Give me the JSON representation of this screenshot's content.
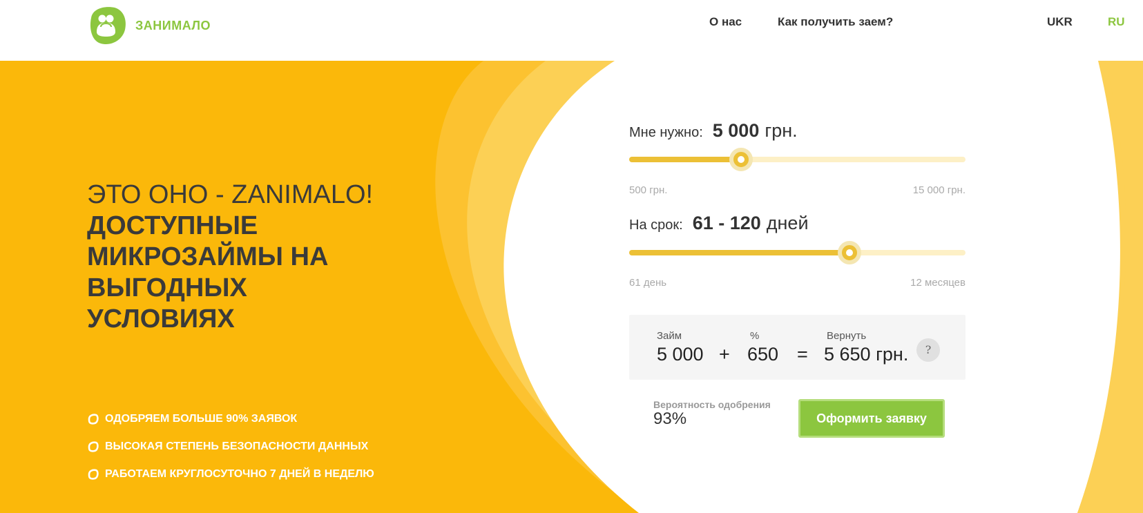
{
  "brand": {
    "name": "ЗАНИМАЛО",
    "color": "#8cc63f"
  },
  "nav": {
    "about": "О нас",
    "how_to": "Как получить заем?",
    "lang_ukr": "UKR",
    "lang_ru": "RU",
    "active_lang": "RU"
  },
  "hero": {
    "title_light": "ЭТО ОНО - ZANIMALO!",
    "title_bold": "ДОСТУПНЫЕ МИКРОЗАЙМЫ НА ВЫГОДНЫХ УСЛОВИЯХ",
    "features": [
      "ОДОБРЯЕМ БОЛЬШЕ 90% ЗАЯВОК",
      "ВЫСОКАЯ СТЕПЕНЬ БЕЗОПАСНОСТИ ДАННЫХ",
      "РАБОТАЕМ КРУГЛОСУТОЧНО 7 ДНЕЙ В НЕДЕЛЮ"
    ],
    "background_color": "#fbb80a"
  },
  "calculator": {
    "amount": {
      "label": "Мне нужно:",
      "value": "5 000",
      "unit": "грн.",
      "min_label": "500 грн.",
      "max_label": "15 000 грн.",
      "fill_fraction": 0.333
    },
    "term": {
      "label": "На срок:",
      "value": "61 - 120",
      "unit": "дней",
      "min_label": "61 день",
      "max_label": "12 месяцев",
      "fill_fraction": 0.655
    },
    "summary": {
      "loan_label": "Займ",
      "loan_value": "5 000",
      "plus": "+",
      "percent_label": "%",
      "percent_value": "650",
      "equals": "=",
      "return_label": "Вернуть",
      "return_value": "5 650 грн.",
      "help": "?"
    },
    "approval_label": "Вероятность одобрения",
    "approval_value": "93%",
    "apply_button": "Оформить заявку"
  }
}
